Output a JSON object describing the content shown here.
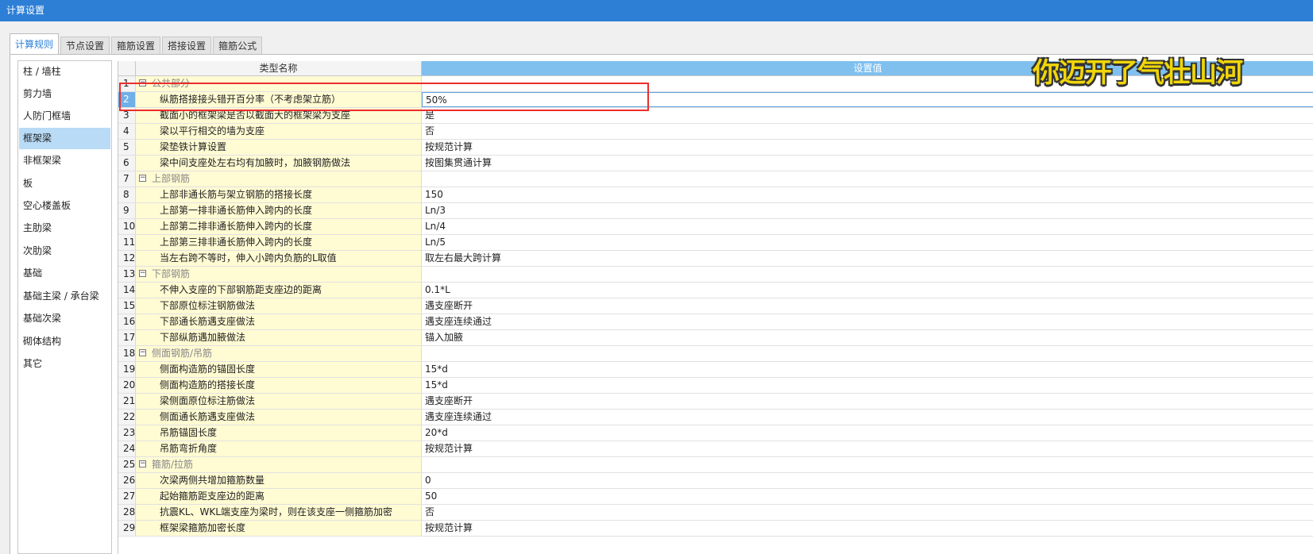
{
  "window": {
    "title": "计算设置"
  },
  "tabs": [
    {
      "label": "计算规则",
      "active": true
    },
    {
      "label": "节点设置",
      "active": false
    },
    {
      "label": "箍筋设置",
      "active": false
    },
    {
      "label": "搭接设置",
      "active": false
    },
    {
      "label": "箍筋公式",
      "active": false
    }
  ],
  "sidebar": {
    "items": [
      {
        "label": "柱 / 墙柱"
      },
      {
        "label": "剪力墙"
      },
      {
        "label": "人防门框墙"
      },
      {
        "label": "框架梁",
        "active": true
      },
      {
        "label": "非框架梁"
      },
      {
        "label": "板"
      },
      {
        "label": "空心楼盖板"
      },
      {
        "label": "主肋梁"
      },
      {
        "label": "次肋梁"
      },
      {
        "label": "基础"
      },
      {
        "label": "基础主梁 / 承台梁"
      },
      {
        "label": "基础次梁"
      },
      {
        "label": "砌体结构"
      },
      {
        "label": "其它"
      }
    ]
  },
  "grid": {
    "headers": {
      "name": "类型名称",
      "value": "设置值"
    },
    "rows": [
      {
        "num": "1",
        "type": "group",
        "name": "公共部分",
        "value": ""
      },
      {
        "num": "2",
        "type": "item",
        "name": "纵筋搭接接头错开百分率（不考虑架立筋）",
        "value": "50%",
        "selected": true
      },
      {
        "num": "3",
        "type": "item",
        "name": "截面小的框架梁是否以截面大的框架梁为支座",
        "value": "是"
      },
      {
        "num": "4",
        "type": "item",
        "name": "梁以平行相交的墙为支座",
        "value": "否"
      },
      {
        "num": "5",
        "type": "item",
        "name": "梁垫铁计算设置",
        "value": "按规范计算"
      },
      {
        "num": "6",
        "type": "item",
        "name": "梁中间支座处左右均有加腋时，加腋钢筋做法",
        "value": "按图集贯通计算"
      },
      {
        "num": "7",
        "type": "group",
        "name": "上部钢筋",
        "value": ""
      },
      {
        "num": "8",
        "type": "item",
        "name": "上部非通长筋与架立钢筋的搭接长度",
        "value": "150"
      },
      {
        "num": "9",
        "type": "item",
        "name": "上部第一排非通长筋伸入跨内的长度",
        "value": "Ln/3"
      },
      {
        "num": "10",
        "type": "item",
        "name": "上部第二排非通长筋伸入跨内的长度",
        "value": "Ln/4"
      },
      {
        "num": "11",
        "type": "item",
        "name": "上部第三排非通长筋伸入跨内的长度",
        "value": "Ln/5"
      },
      {
        "num": "12",
        "type": "item",
        "name": "当左右跨不等时，伸入小跨内负筋的L取值",
        "value": "取左右最大跨计算"
      },
      {
        "num": "13",
        "type": "group",
        "name": "下部钢筋",
        "value": ""
      },
      {
        "num": "14",
        "type": "item",
        "name": "不伸入支座的下部钢筋距支座边的距离",
        "value": "0.1*L"
      },
      {
        "num": "15",
        "type": "item",
        "name": "下部原位标注钢筋做法",
        "value": "遇支座断开"
      },
      {
        "num": "16",
        "type": "item",
        "name": "下部通长筋遇支座做法",
        "value": "遇支座连续通过"
      },
      {
        "num": "17",
        "type": "item",
        "name": "下部纵筋遇加腋做法",
        "value": "锚入加腋"
      },
      {
        "num": "18",
        "type": "group",
        "name": "侧面钢筋/吊筋",
        "value": ""
      },
      {
        "num": "19",
        "type": "item",
        "name": "侧面构造筋的锚固长度",
        "value": "15*d"
      },
      {
        "num": "20",
        "type": "item",
        "name": "侧面构造筋的搭接长度",
        "value": "15*d"
      },
      {
        "num": "21",
        "type": "item",
        "name": "梁侧面原位标注筋做法",
        "value": "遇支座断开"
      },
      {
        "num": "22",
        "type": "item",
        "name": "侧面通长筋遇支座做法",
        "value": "遇支座连续通过"
      },
      {
        "num": "23",
        "type": "item",
        "name": "吊筋锚固长度",
        "value": "20*d"
      },
      {
        "num": "24",
        "type": "item",
        "name": "吊筋弯折角度",
        "value": "按规范计算"
      },
      {
        "num": "25",
        "type": "group",
        "name": "箍筋/拉筋",
        "value": ""
      },
      {
        "num": "26",
        "type": "item",
        "name": "次梁两侧共增加箍筋数量",
        "value": "0"
      },
      {
        "num": "27",
        "type": "item",
        "name": "起始箍筋距支座边的距离",
        "value": "50"
      },
      {
        "num": "28",
        "type": "item",
        "name": "抗震KL、WKL端支座为梁时，则在该支座一侧箍筋加密",
        "value": "否"
      },
      {
        "num": "29",
        "type": "item",
        "name": "框架梁箍筋加密长度",
        "value": "按规范计算"
      }
    ]
  },
  "overlay": {
    "caption": "你迈开了气壮山河"
  },
  "colors": {
    "accent": "#2d7fd6",
    "highlight": "#ec2d2d",
    "name_cell_bg": "#fffbd3"
  }
}
